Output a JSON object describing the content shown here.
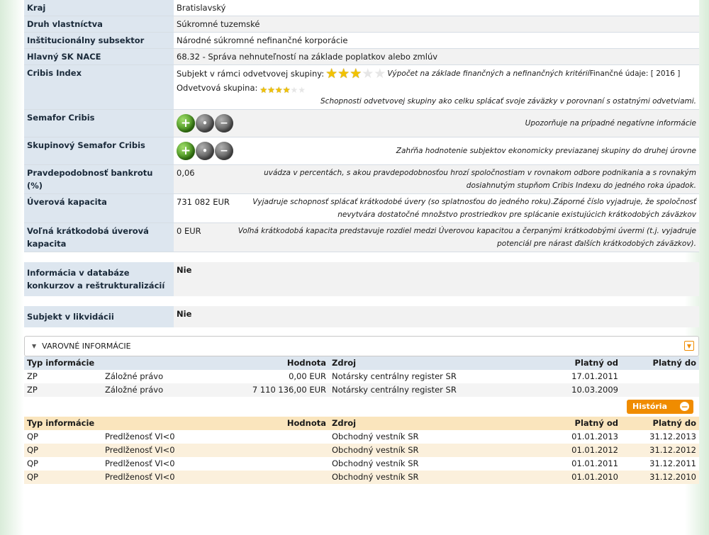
{
  "info": {
    "kraj": {
      "label": "Kraj",
      "value": "Bratislavský"
    },
    "druh": {
      "label": "Druh vlastníctva",
      "value": "Súkromné tuzemské"
    },
    "subsektor": {
      "label": "Inštitucionálny subsektor",
      "value": "Národné súkromné nefinančné korporácie"
    },
    "nace": {
      "label": "Hlavný SK NACE",
      "value": "68.32 - Správa nehnuteľností na základe poplatkov alebo zmlúv"
    },
    "cribis_index": {
      "label": "Cribis Index",
      "subject_label": "Subjekt v rámci odvetvovej skupiny:",
      "subject_stars": 3,
      "calc_note": "Výpočet na základe finančných a nefinančných kritérií",
      "fin_udaje": "Finančné údaje: [ 2016 ]",
      "group_label": "Odvetvová skupina:",
      "group_stars": 4,
      "group_note": "Schopnosti odvetvovej skupiny ako celku splácať svoje záväzky v porovnaní s ostatnými odvetviami."
    },
    "semafor": {
      "label": "Semafor Cribis",
      "desc": "Upozorňuje na prípadné negatívne informácie"
    },
    "skup_semafor": {
      "label": "Skupinový Semafor Cribis",
      "desc": "Zahŕňa hodnotenie subjektov ekonomicky previazanej skupiny do druhej úrovne"
    },
    "bankrot": {
      "label": "Pravdepodobnosť bankrotu (%)",
      "value": "0,06",
      "desc": "uvádza v percentách, s akou pravdepodobnosťou hrozí spoločnostiam v rovnakom odbore podnikania a s rovnakým dosiahnutým stupňom Cribis Indexu do jedného roka úpadok."
    },
    "uverova": {
      "label": "Úverová kapacita",
      "value": "731 082 EUR",
      "desc": "Vyjadruje schopnosť splácať krátkodobé úvery (so splatnosťou do jedného roku).Záporné číslo vyjadruje, že spoločnosť nevytvára dostatočné množstvo prostriedkov pre splácanie existujúcich krátkodobých záväzkov"
    },
    "volna": {
      "label": "Voľná krátkodobá úverová kapacita",
      "value": "0 EUR",
      "desc": "Voľná krátkodobá kapacita predstavuje rozdiel medzi Úverovou kapacitou a čerpanými krátkodobými úvermi (t.j. vyjadruje potenciál pre nárast ďalších krátkodobých záväzkov)."
    },
    "konkurz": {
      "label": "Informácia v databáze konkurzov a reštrukturalizácií",
      "value": "Nie"
    },
    "likvidacia": {
      "label": "Subjekt v likvidácii",
      "value": "Nie"
    }
  },
  "warnings": {
    "title": "VAROVNÉ INFORMÁCIE",
    "headers": [
      "Typ informácie",
      "",
      "Hodnota",
      "Zdroj",
      "Platný od",
      "Platný do"
    ],
    "rows": [
      [
        "ZP",
        "Záložné právo",
        "0,00 EUR",
        "Notársky centrálny register SR",
        "17.01.2011",
        ""
      ],
      [
        "ZP",
        "Záložné právo",
        "7 110 136,00 EUR",
        "Notársky centrálny register SR",
        "10.03.2009",
        ""
      ]
    ],
    "history_button": "História",
    "history_headers": [
      "Typ informácie",
      "",
      "Hodnota",
      "Zdroj",
      "Platný od",
      "Platný do"
    ],
    "history_rows": [
      [
        "QP",
        "Predlženosť VI<0",
        "",
        "Obchodný vestník SR",
        "01.01.2013",
        "31.12.2013"
      ],
      [
        "QP",
        "Predlženosť VI<0",
        "",
        "Obchodný vestník SR",
        "01.01.2012",
        "31.12.2012"
      ],
      [
        "QP",
        "Predlženosť VI<0",
        "",
        "Obchodný vestník SR",
        "01.01.2011",
        "31.12.2011"
      ],
      [
        "QP",
        "Predlženosť VI<0",
        "",
        "Obchodný vestník SR",
        "01.01.2010",
        "31.12.2010"
      ]
    ]
  }
}
